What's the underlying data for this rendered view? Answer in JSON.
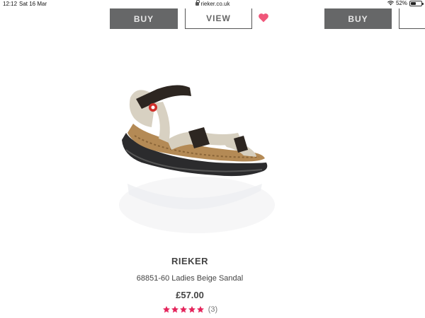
{
  "status_bar": {
    "time": "12:12",
    "date": "Sat 16 Mar",
    "url": "rieker.co.uk",
    "battery": "52%",
    "battery_level": 0.52
  },
  "cards_top": {
    "buy_label": "BUY",
    "view_label": "VIEW"
  },
  "product": {
    "brand": "RIEKER",
    "name": "68851-60 Ladies Beige Sandal",
    "price": "£57.00",
    "rating": 5,
    "review_count": "(3)",
    "image_icon": "sandal-image"
  },
  "colors": {
    "star": "#e4245b",
    "heart": "#f0577a",
    "button_dark": "#666768"
  }
}
